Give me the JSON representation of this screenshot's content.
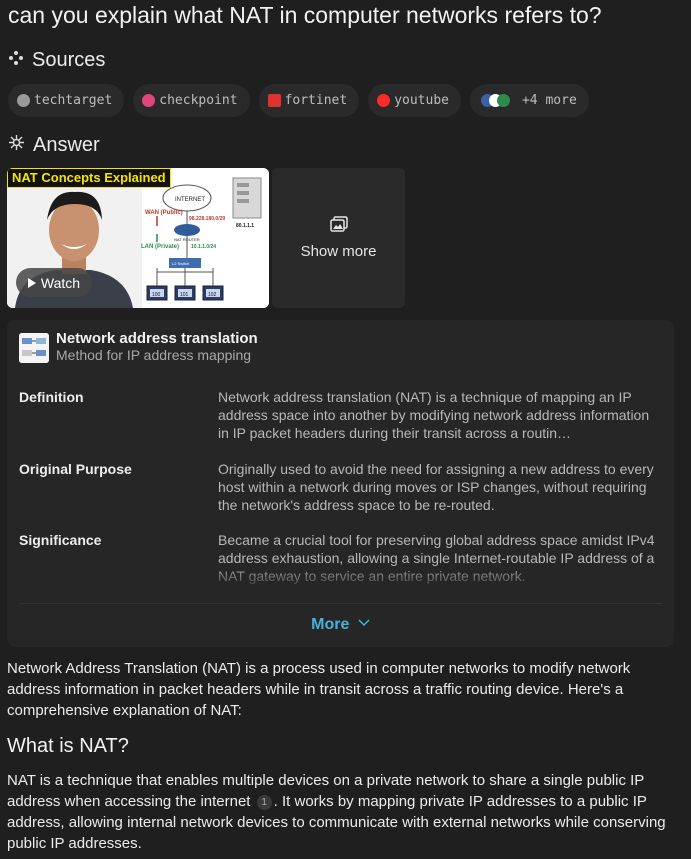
{
  "question": "can you explain what NAT in computer networks refers to?",
  "sources": {
    "heading": "Sources",
    "items": [
      {
        "label": "techtarget",
        "color": "#9a9a9a"
      },
      {
        "label": "checkpoint",
        "color": "#e0457b"
      },
      {
        "label": "fortinet",
        "color": "#e0332f"
      },
      {
        "label": "youtube",
        "color": "#ff2a2a"
      }
    ],
    "more_label": "+4 more"
  },
  "answer_heading": "Answer",
  "video": {
    "title": "NAT Concepts Explained",
    "watch_label": "Watch",
    "diagram": {
      "internet": "INTERNET",
      "wan": "WAN (Public)",
      "wan_ip": "98.228.180.0/29",
      "server_ip": "80.1.1.1",
      "lan": "LAN (Private)",
      "lan_ip": "10.1.1.0/24",
      "router": "NAT ROUTER",
      "switch": "L2 Switch",
      "pc1": "100",
      "pc2": "101",
      "pc3": "102"
    }
  },
  "show_more_label": "Show more",
  "knowledge": {
    "title": "Network address translation",
    "subtitle": "Method for IP address mapping",
    "rows": [
      {
        "label": "Definition",
        "text": "Network address translation (NAT) is a technique of mapping an IP address space into another by modifying network address information in IP packet headers during their transit across a routin…"
      },
      {
        "label": "Original Purpose",
        "text": "Originally used to avoid the need for assigning a new address to every host within a network during moves or ISP changes, without requiring the network's address space to be re-routed."
      },
      {
        "label": "Significance",
        "text": "Became a crucial tool for preserving global address space amidst IPv4 address exhaustion, allowing a single Internet-routable IP address of a NAT gateway to service an entire private network."
      }
    ],
    "more_label": "More"
  },
  "intro": "Network Address Translation (NAT) is a process used in computer networks to modify network address information in packet headers while in transit across a traffic routing device. Here's a comprehensive explanation of NAT:",
  "section1": {
    "heading": "What is NAT?",
    "text_a": "NAT is a technique that enables multiple devices on a private network to share a single public IP address when accessing the internet",
    "citation": "1",
    "text_b": ". It works by mapping private IP addresses to a public IP address, allowing internal network devices to communicate with external networks while conserving public IP addresses."
  }
}
